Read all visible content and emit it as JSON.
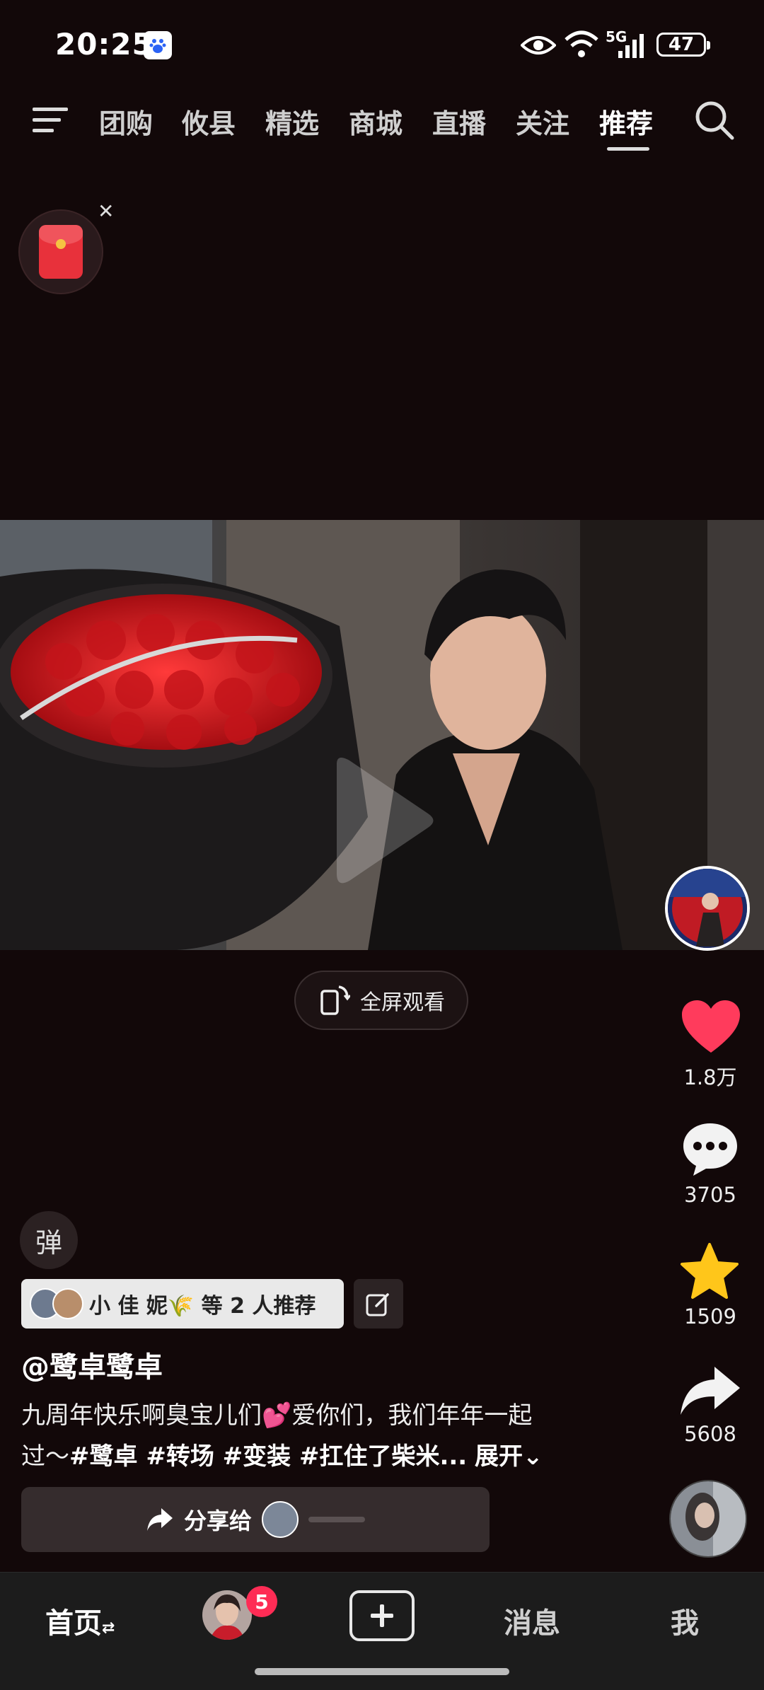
{
  "status_bar": {
    "time": "20:25",
    "network": "5G",
    "battery": "47"
  },
  "top_nav": {
    "tabs": [
      "团购",
      "攸县",
      "精选",
      "商城",
      "直播",
      "关注",
      "推荐"
    ],
    "active_tab": "推荐"
  },
  "video": {
    "fullscreen_label": "全屏观看"
  },
  "actions": {
    "likes": "1.8万",
    "comments": "3705",
    "favorites": "1509",
    "shares": "5608"
  },
  "danmu_label": "弹",
  "recommend": {
    "text": "小 佳 妮🌾 等 2 人推荐"
  },
  "author": "@鹭卓鹭卓",
  "caption": {
    "text_line1": "九周年快乐啊臭宝儿们💕爱你们，我们年年一起",
    "text_line2_prefix": "过～",
    "hashtags": "#鹭卓 #转场 #变装 #扛住了柴米...",
    "expand": "展开"
  },
  "share_bar": {
    "label": "分享给"
  },
  "bottom_nav": {
    "home": "首页",
    "friend_badge": "5",
    "messages": "消息",
    "me": "我"
  },
  "colors": {
    "accent": "#fe2c55",
    "like": "#ff3b5c",
    "star": "#ffc61a",
    "background": "#120809"
  }
}
